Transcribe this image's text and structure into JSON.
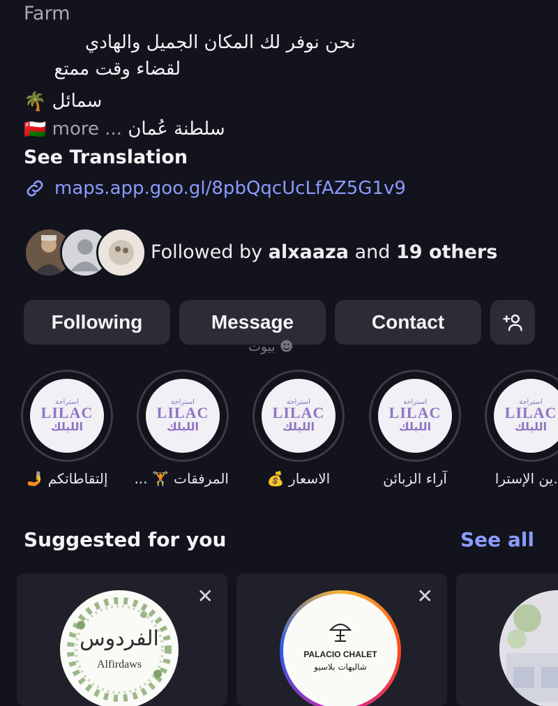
{
  "profile": {
    "category": "Farm",
    "bio_line1": "نحن نوفر لك المكان الجميل والهادي",
    "bio_line2": "لقضاء وقت ممتع",
    "bio_line3": "سمائل",
    "bio_line4": "سلطنة عُمان",
    "more_label": "more ...",
    "see_translation": "See Translation",
    "link": "maps.app.goo.gl/8pbQqcUcLfAZ5G1v9",
    "followed_by_prefix": "Followed by ",
    "followed_by_user": "alxaaza",
    "followed_by_middle": " and ",
    "followed_by_others": "19 others"
  },
  "actions": {
    "following": "Following",
    "message": "Message",
    "contact": "Contact",
    "add_user_icon": "+👤"
  },
  "watermark": "بيوت",
  "highlights": [
    {
      "label": "...ين الإسترا",
      "logo_top": "استراحة",
      "logo_main": "الليلك",
      "logo_en": "LILAC"
    },
    {
      "label": "آراء الزبائن",
      "logo_top": "استراحة",
      "logo_main": "الليلك",
      "logo_en": "LILAC"
    },
    {
      "label": "الاسعار 💰",
      "logo_top": "استراحة",
      "logo_main": "الليلك",
      "logo_en": "LILAC"
    },
    {
      "label": "المرفقات 🏋 ...",
      "logo_top": "استراحة",
      "logo_main": "الليلك",
      "logo_en": "LILAC"
    },
    {
      "label": "إلتقاطاتكم 🤳",
      "logo_top": "استراحة",
      "logo_main": "الليلك",
      "logo_en": "LILAC"
    }
  ],
  "suggested": {
    "title": "Suggested for you",
    "see_all": "See all",
    "cards": [
      {
        "arabic_name": "الفردوس",
        "name": "Alfirdaws"
      },
      {
        "name": "PALACIO CHALET",
        "arabic_name": "شاليهات بلاسيو"
      }
    ]
  },
  "colors": {
    "background": "#12131c",
    "button": "#2b2c35",
    "link": "#8b9bff",
    "lilac": "#8e74c2"
  }
}
